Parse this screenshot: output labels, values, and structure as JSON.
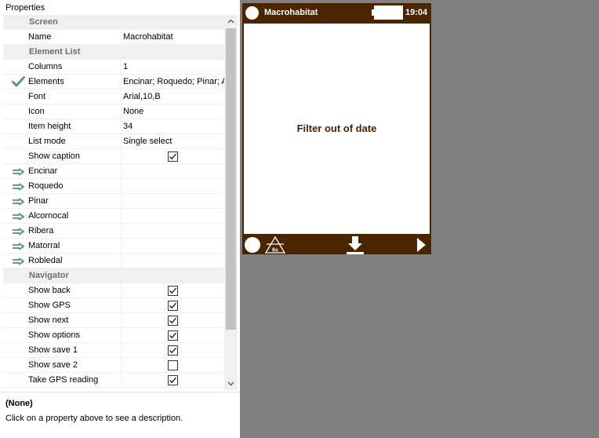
{
  "properties_panel": {
    "title": "Properties",
    "rows": [
      {
        "kind": "category",
        "name": "Screen"
      },
      {
        "kind": "prop",
        "name": "Name",
        "value": "Macrohabitat"
      },
      {
        "kind": "category",
        "name": "Element List"
      },
      {
        "kind": "prop",
        "name": "Columns",
        "value": "1"
      },
      {
        "kind": "prop",
        "name": "Elements",
        "value": "Encinar; Roquedo; Pinar; A",
        "marker": "check-icon"
      },
      {
        "kind": "prop",
        "name": "Font",
        "value": "Arial,10,B"
      },
      {
        "kind": "prop",
        "name": "Icon",
        "value": "None"
      },
      {
        "kind": "prop",
        "name": "Item height",
        "value": "34"
      },
      {
        "kind": "prop",
        "name": "List mode",
        "value": "Single select"
      },
      {
        "kind": "check",
        "name": "Show caption",
        "checked": true
      },
      {
        "kind": "prop",
        "name": "Encinar",
        "value": "",
        "marker": "arrow-icon"
      },
      {
        "kind": "prop",
        "name": "Roquedo",
        "value": "",
        "marker": "arrow-icon"
      },
      {
        "kind": "prop",
        "name": "Pinar",
        "value": "",
        "marker": "arrow-icon"
      },
      {
        "kind": "prop",
        "name": "Alcornocal",
        "value": "",
        "marker": "arrow-icon"
      },
      {
        "kind": "prop",
        "name": "Ribera",
        "value": "",
        "marker": "arrow-icon"
      },
      {
        "kind": "prop",
        "name": "Matorral",
        "value": "",
        "marker": "arrow-icon"
      },
      {
        "kind": "prop",
        "name": "Robledal",
        "value": "",
        "marker": "arrow-icon"
      },
      {
        "kind": "category",
        "name": "Navigator"
      },
      {
        "kind": "check",
        "name": "Show back",
        "checked": true
      },
      {
        "kind": "check",
        "name": "Show GPS",
        "checked": true
      },
      {
        "kind": "check",
        "name": "Show next",
        "checked": true
      },
      {
        "kind": "check",
        "name": "Show options",
        "checked": true
      },
      {
        "kind": "check",
        "name": "Show save 1",
        "checked": true
      },
      {
        "kind": "check",
        "name": "Show save 2",
        "checked": false
      },
      {
        "kind": "check",
        "name": "Take GPS reading",
        "checked": true
      }
    ],
    "description": {
      "title": "(None)",
      "text": "Click on a property above to see a description."
    }
  },
  "device_preview": {
    "title": "Macrohabitat",
    "time": "19:04",
    "message": "Filter out of date",
    "gps_icon_label": "6s",
    "colors": {
      "bar": "#4b2400",
      "screen": "#ffffff",
      "message": "#4b2400",
      "workspace": "#808080"
    },
    "icons": [
      "circle-menu-icon",
      "battery-icon",
      "back-circle-icon",
      "gps-icon",
      "save-icon",
      "next-arrow-icon"
    ]
  }
}
